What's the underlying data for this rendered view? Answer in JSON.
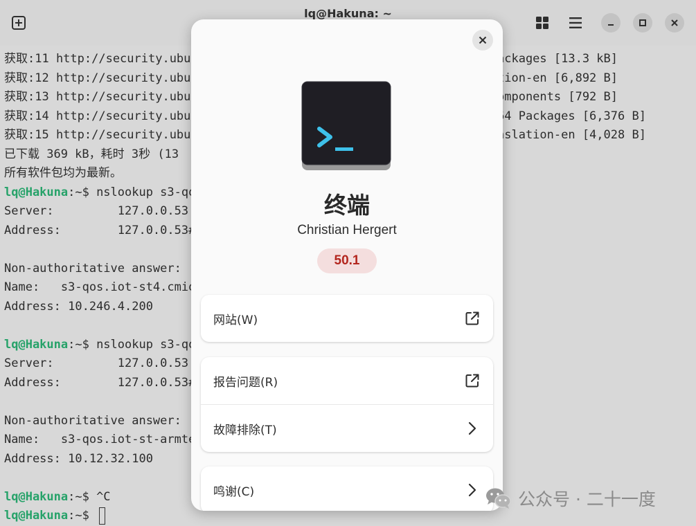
{
  "window": {
    "title": "lq@Hakuna: ~"
  },
  "terminal": {
    "lines": [
      {
        "prompt": "",
        "text": "获取:11 http://security.ubu"
      },
      {
        "prompt": "",
        "text": "获取:12 http://security.ubu"
      },
      {
        "prompt": "",
        "text": "获取:13 http://security.ubu"
      },
      {
        "prompt": "",
        "text": "获取:14 http://security.ubu"
      },
      {
        "prompt": "",
        "text": "获取:15 http://security.ubu"
      },
      {
        "prompt": "",
        "text": "已下载 369 kB，耗时 3秒 (13"
      },
      {
        "prompt": "",
        "text": "所有软件包均为最新。"
      },
      {
        "prompt": "lq@Hakuna",
        "text": ":~$ nslookup s3-qo"
      },
      {
        "prompt": "",
        "text": "Server:         127.0.0.53"
      },
      {
        "prompt": "",
        "text": "Address:        127.0.0.53#"
      },
      {
        "prompt": "",
        "text": ""
      },
      {
        "prompt": "",
        "text": "Non-authoritative answer:"
      },
      {
        "prompt": "",
        "text": "Name:   s3-qos.iot-st4.cmio"
      },
      {
        "prompt": "",
        "text": "Address: 10.246.4.200"
      },
      {
        "prompt": "",
        "text": ""
      },
      {
        "prompt": "lq@Hakuna",
        "text": ":~$ nslookup s3-qo"
      },
      {
        "prompt": "",
        "text": "Server:         127.0.0.53"
      },
      {
        "prompt": "",
        "text": "Address:        127.0.0.53#"
      },
      {
        "prompt": "",
        "text": ""
      },
      {
        "prompt": "",
        "text": "Non-authoritative answer:"
      },
      {
        "prompt": "",
        "text": "Name:   s3-qos.iot-st-armte"
      },
      {
        "prompt": "",
        "text": "Address: 10.12.32.100"
      },
      {
        "prompt": "",
        "text": ""
      },
      {
        "prompt": "lq@Hakuna",
        "text": ":~$ ^C"
      },
      {
        "prompt": "lq@Hakuna",
        "text": ":~$ "
      }
    ],
    "right_lines": [
      "ackages [13.3 kB]",
      "tion-en [6,892 B]",
      "omponents [792 B]",
      "64 Packages [6,376 B]",
      "nslation-en [4,028 B]"
    ]
  },
  "about": {
    "app_name": "终端",
    "developer": "Christian Hergert",
    "version": "50.1",
    "website_label": "网站(W)",
    "report_label": "报告问题(R)",
    "troubleshoot_label": "故障排除(T)",
    "credits_label": "鸣谢(C)"
  },
  "watermark": {
    "text": "公众号 · 二十一度"
  },
  "colors": {
    "prompt": "#26a269",
    "version_badge_bg": "#f4dede",
    "version_badge_text": "#b3261e",
    "icon_prompt": "#3ec1ea"
  },
  "icons": [
    "new-tab-icon",
    "grid-view-icon",
    "hamburger-menu-icon",
    "minimize-icon",
    "maximize-icon",
    "close-icon",
    "external-link-icon",
    "chevron-right-icon",
    "wechat-icon"
  ]
}
